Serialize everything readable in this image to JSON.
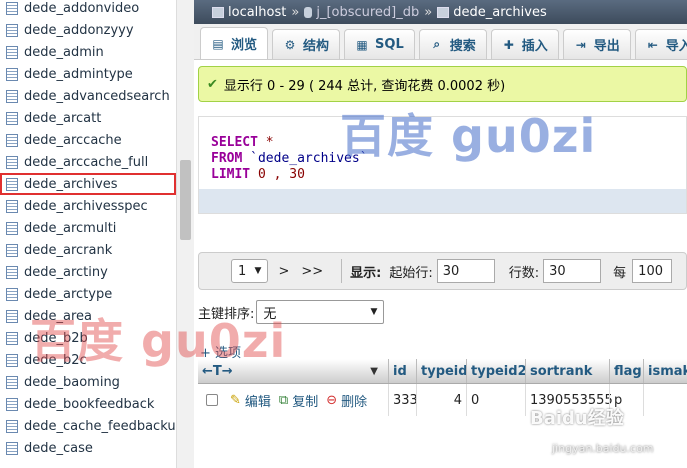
{
  "sidebar": {
    "items": [
      {
        "label": "dede_addonvideo"
      },
      {
        "label": "dede_addonzyyy"
      },
      {
        "label": "dede_admin"
      },
      {
        "label": "dede_admintype"
      },
      {
        "label": "dede_advancedsearch"
      },
      {
        "label": "dede_arcatt"
      },
      {
        "label": "dede_arccache"
      },
      {
        "label": "dede_arccache_full"
      },
      {
        "label": "dede_archives"
      },
      {
        "label": "dede_archivesspec"
      },
      {
        "label": "dede_arcmulti"
      },
      {
        "label": "dede_arcrank"
      },
      {
        "label": "dede_arctiny"
      },
      {
        "label": "dede_arctype"
      },
      {
        "label": "dede_area"
      },
      {
        "label": "dede_b2b"
      },
      {
        "label": "dede_b2c"
      },
      {
        "label": "dede_baoming"
      },
      {
        "label": "dede_bookfeedback"
      },
      {
        "label": "dede_cache_feedbackur"
      },
      {
        "label": "dede_case"
      }
    ],
    "highlight_color": "#e03030"
  },
  "breadcrumb": {
    "server": "localhost",
    "sep": "»",
    "database": "j_[obscured]_db",
    "table": "dede_archives"
  },
  "tabs": [
    {
      "label": "浏览",
      "icon": "browse-icon",
      "glyph": "▤"
    },
    {
      "label": "结构",
      "icon": "structure-icon",
      "glyph": "⚙"
    },
    {
      "label": "SQL",
      "icon": "sql-icon",
      "glyph": "▦"
    },
    {
      "label": "搜索",
      "icon": "search-icon",
      "glyph": "⌕"
    },
    {
      "label": "插入",
      "icon": "insert-icon",
      "glyph": "✚"
    },
    {
      "label": "导出",
      "icon": "export-icon",
      "glyph": "⇥"
    },
    {
      "label": "导入",
      "icon": "import-icon",
      "glyph": "⇤"
    }
  ],
  "notice": {
    "text": "显示行 0 - 29 ( 244 总计, 查询花费 0.0002 秒)"
  },
  "sql": {
    "select": "SELECT",
    "star": "*",
    "from": "FROM",
    "table": "`dede_archives`",
    "limit": "LIMIT",
    "limit_value": "0 , 30"
  },
  "nav": {
    "page_select": "1",
    "next": ">",
    "last": ">>",
    "show_label": "显示:",
    "start_label": "起始行:",
    "start_value": "30",
    "rows_label": "行数:",
    "rows_value": "30",
    "per_label": "每",
    "per_value": "100"
  },
  "sort": {
    "label": "主键排序:",
    "value": "无"
  },
  "options": {
    "label": "+ 选项"
  },
  "grid": {
    "arrows": "←T→",
    "columns": [
      "id",
      "typeid",
      "typeid2",
      "sortrank",
      "flag",
      "ismake"
    ],
    "row": {
      "edit": "编辑",
      "copy": "复制",
      "delete": "删除",
      "id": "333",
      "typeid": "4",
      "typeid2": "0",
      "sortrank": "1390553555",
      "flag": "p"
    }
  },
  "watermarks": {
    "blue": "百度 gu0zi",
    "red": "百度 gu0zi",
    "baidu": "Baidu经验",
    "url": "jingyan.baidu.com"
  }
}
